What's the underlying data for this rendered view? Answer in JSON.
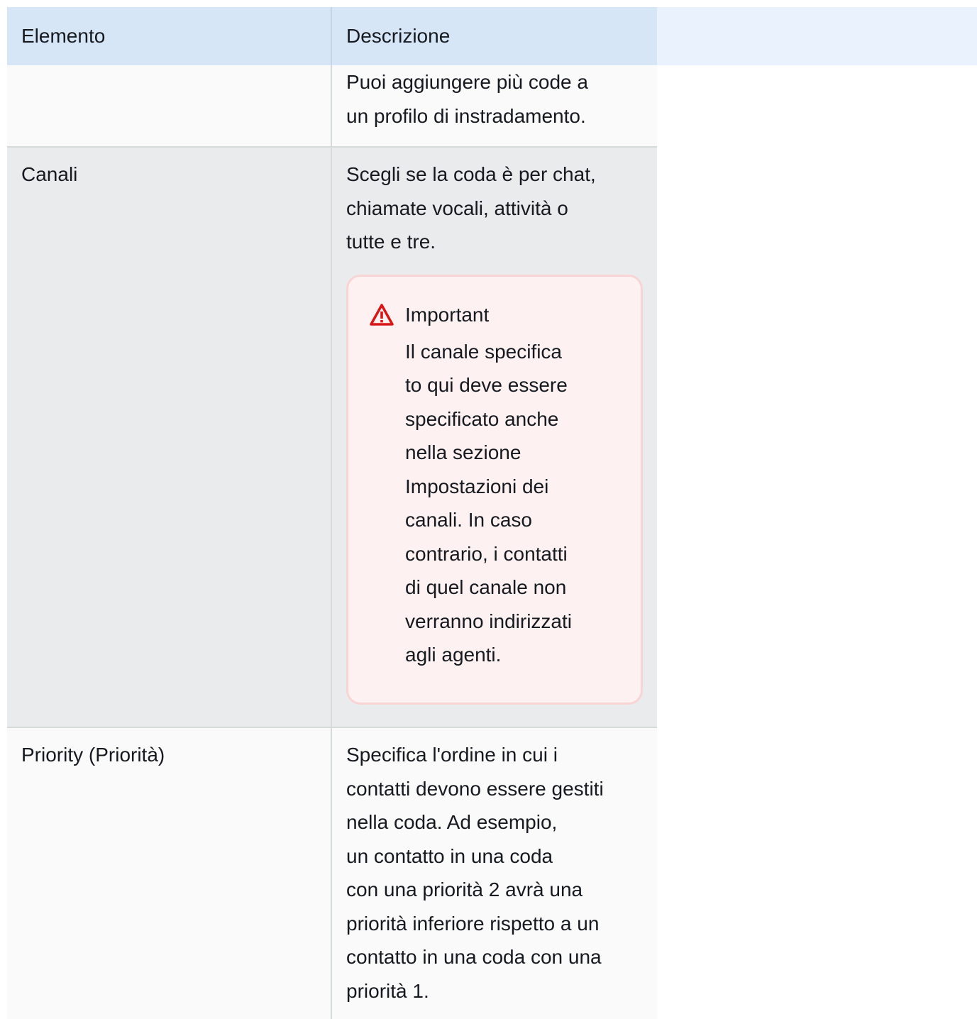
{
  "table": {
    "headers": [
      "Elemento",
      "Descrizione",
      ""
    ],
    "rows": [
      {
        "element": "",
        "description": [
          "Puoi aggiungere più code a",
          "un profilo di instradamento."
        ]
      },
      {
        "element": "Canali",
        "description": [
          "Scegli se la coda è per chat,",
          "chiamate vocali, attività o",
          "tutte e tre."
        ],
        "alert": {
          "icon": "warning-icon",
          "title": "Important",
          "body": [
            "Il canale specifica",
            "to qui deve essere",
            "specificato anche",
            "nella sezione",
            "Impostazioni dei",
            "canali. In caso",
            "contrario, i contatti",
            "di quel canale non",
            "verranno indirizzati",
            "agli agenti."
          ]
        }
      },
      {
        "element": "Priority (Priorità)",
        "description": [
          "Specifica l'ordine in cui i",
          "contatti devono essere gestiti",
          "nella coda. Ad esempio,",
          "un contatto in una coda",
          "con una priorità 2 avrà una",
          "priorità inferiore rispetto a un",
          "contatto in una coda con una",
          "priorità 1."
        ]
      }
    ]
  },
  "colors": {
    "header_bg": "#d6e6f7",
    "header_bg_light": "#eaf2fd",
    "row_light": "#fafafa",
    "row_gray": "#eaebed",
    "alert_bg": "#fdf2f1",
    "alert_border": "#f9d4d4",
    "warning_red": "#d91515"
  }
}
